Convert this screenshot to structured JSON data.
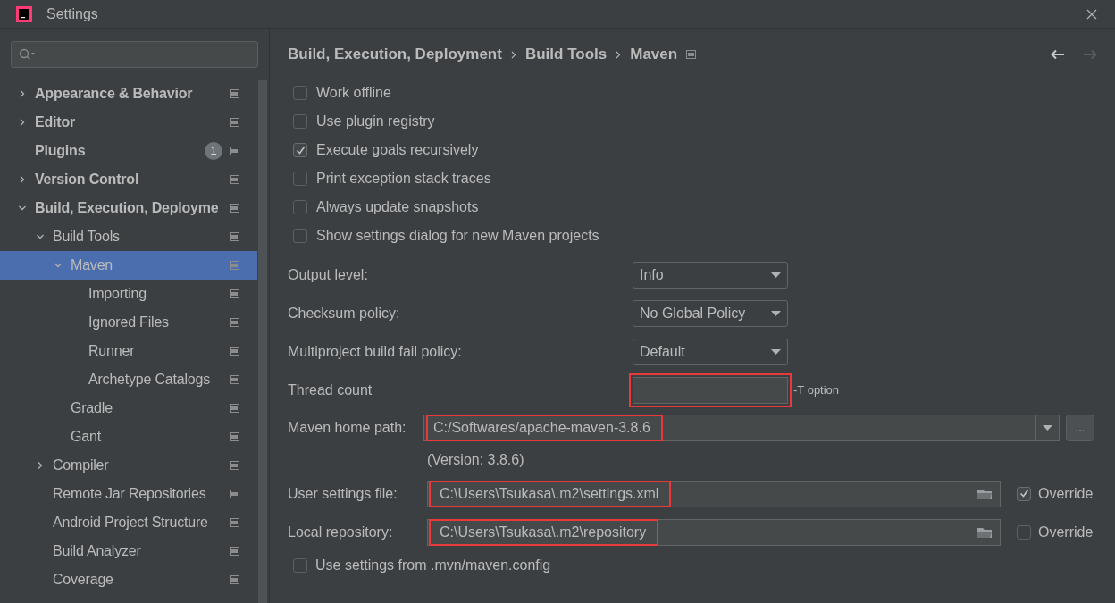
{
  "window": {
    "title": "Settings"
  },
  "sidebar": {
    "items": [
      {
        "label": "Appearance & Behavior",
        "bold": true,
        "expanded": false,
        "selected": false
      },
      {
        "label": "Editor",
        "bold": true,
        "expanded": false,
        "selected": false
      },
      {
        "label": "Plugins",
        "bold": true,
        "selected": false,
        "badge": "1"
      },
      {
        "label": "Version Control",
        "bold": true,
        "expanded": false,
        "selected": false
      },
      {
        "label": "Build, Execution, Deployme",
        "bold": true,
        "expanded": true,
        "selected": false,
        "children": [
          {
            "label": "Build Tools",
            "expanded": true,
            "selected": false,
            "children": [
              {
                "label": "Maven",
                "expanded": true,
                "selected": true,
                "children": [
                  {
                    "label": "Importing",
                    "selected": false
                  },
                  {
                    "label": "Ignored Files",
                    "selected": false
                  },
                  {
                    "label": "Runner",
                    "selected": false
                  },
                  {
                    "label": "Archetype Catalogs",
                    "selected": false
                  }
                ]
              },
              {
                "label": "Gradle",
                "selected": false
              },
              {
                "label": "Gant",
                "selected": false
              }
            ]
          },
          {
            "label": "Compiler",
            "expanded": false,
            "selected": false
          },
          {
            "label": "Remote Jar Repositories",
            "selected": false
          },
          {
            "label": "Android Project Structure",
            "selected": false
          },
          {
            "label": "Build Analyzer",
            "selected": false
          },
          {
            "label": "Coverage",
            "selected": false
          }
        ]
      }
    ]
  },
  "breadcrumb": [
    "Build, Execution, Deployment",
    "Build Tools",
    "Maven"
  ],
  "options": [
    {
      "label": "Work offline",
      "checked": false
    },
    {
      "label": "Use plugin registry",
      "checked": false
    },
    {
      "label": "Execute goals recursively",
      "checked": true
    },
    {
      "label": "Print exception stack traces",
      "checked": false
    },
    {
      "label": "Always update snapshots",
      "checked": false
    },
    {
      "label": "Show settings dialog for new Maven projects",
      "checked": false
    }
  ],
  "selects": [
    {
      "label": "Output level:",
      "value": "Info"
    },
    {
      "label": "Checksum policy:",
      "value": "No Global Policy"
    },
    {
      "label": "Multiproject build fail policy:",
      "value": "Default"
    }
  ],
  "thread_count": {
    "label": "Thread count",
    "hint": "-T option",
    "highlighted": true
  },
  "maven_home": {
    "label": "Maven home path:",
    "value": "C:/Softwares/apache-maven-3.8.6",
    "highlighted": true,
    "button": "...",
    "version": "(Version: 3.8.6)"
  },
  "files": [
    {
      "label": "User settings file:",
      "value": "C:\\Users\\Tsukasa\\.m2\\settings.xml",
      "highlighted": true,
      "override_label": "Override",
      "override": true
    },
    {
      "label": "Local repository:",
      "value": "C:\\Users\\Tsukasa\\.m2\\repository",
      "highlighted": true,
      "override_label": "Override",
      "override": false
    }
  ],
  "bottom_option": {
    "label": "Use settings from .mvn/maven.config",
    "checked": false
  }
}
